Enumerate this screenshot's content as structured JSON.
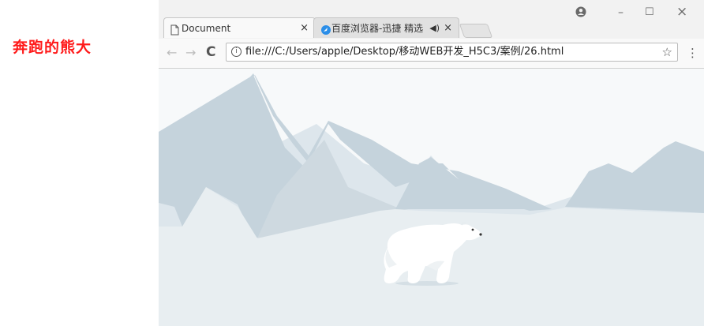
{
  "slide": {
    "title": "奔跑的熊大"
  },
  "tabs": [
    {
      "label": "Document",
      "icon": "page-icon",
      "active": true
    },
    {
      "label": "百度浏览器-迅捷 精选",
      "icon": "baidu-browser-icon",
      "active": false,
      "audio": true
    }
  ],
  "toolbar": {
    "url": "file:///C:/Users/apple/Desktop/移动WEB开发_H5C3/案例/26.html"
  },
  "icons": {
    "back": "←",
    "forward": "→",
    "reload": "C",
    "star": "☆",
    "menu": "⋮",
    "close": "×",
    "minimize": "–",
    "maximize": "☐",
    "account": "account-icon",
    "mute": "◀)"
  },
  "colors": {
    "title_red": "#ff1a1a",
    "mountain_dark": "#c5d3dc",
    "mountain_light": "#dde6ec",
    "ground": "#e8eef1",
    "sky": "#f7f9fa"
  }
}
